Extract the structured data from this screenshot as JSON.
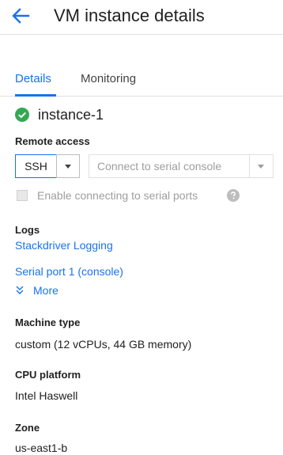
{
  "header": {
    "title": "VM instance details",
    "back_icon": "arrow-back-icon"
  },
  "tabs": [
    {
      "label": "Details",
      "active": true
    },
    {
      "label": "Monitoring",
      "active": false
    }
  ],
  "instance": {
    "name": "instance-1",
    "status": "running",
    "status_icon": "check-circle-icon",
    "status_color": "#34a853"
  },
  "remote_access": {
    "label": "Remote access",
    "ssh_label": "SSH",
    "serial_console_label": "Connect to serial console",
    "serial_ports_checkbox_label": "Enable connecting to serial ports",
    "serial_ports_enabled": false
  },
  "logs": {
    "label": "Logs",
    "links": [
      "Stackdriver Logging",
      "Serial port 1 (console)"
    ],
    "more_label": "More"
  },
  "machine_type": {
    "label": "Machine type",
    "value": "custom (12 vCPUs, 44 GB memory)"
  },
  "cpu_platform": {
    "label": "CPU platform",
    "value": "Intel Haswell"
  },
  "zone": {
    "label": "Zone",
    "value": "us-east1-b"
  },
  "colors": {
    "accent": "#1a73e8",
    "text": "#212121",
    "disabled": "#9e9e9e",
    "divider": "#e0e0e0"
  }
}
